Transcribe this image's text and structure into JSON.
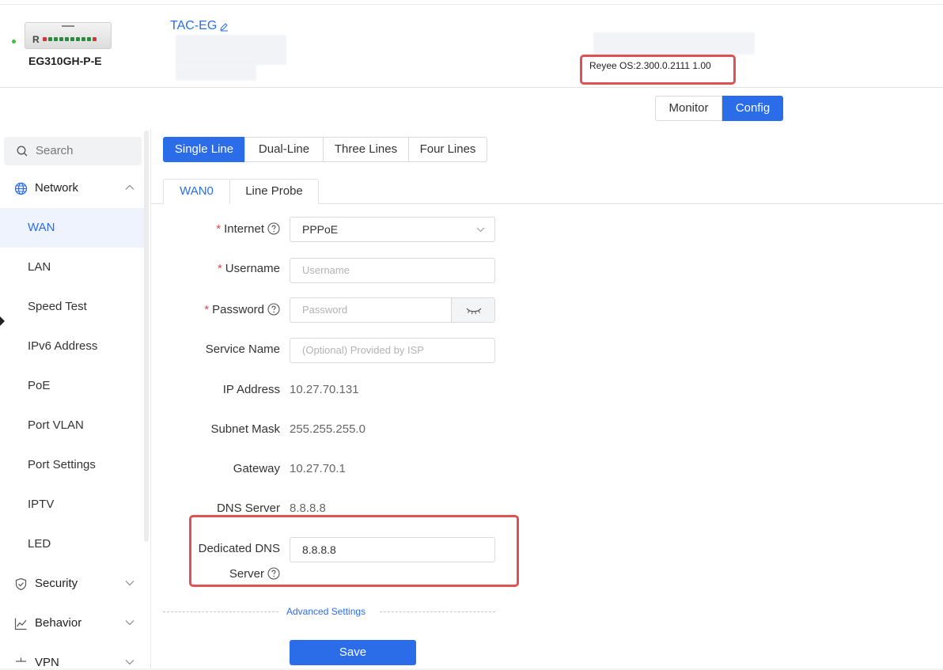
{
  "header": {
    "brand_letter": "R",
    "model": "EG310GH-P-E",
    "device_name": "TAC-EG",
    "os_version": "Reyee OS:2.300.0.2111 1.00"
  },
  "mode": {
    "monitor_label": "Monitor",
    "config_label": "Config",
    "active": "Config"
  },
  "sidebar": {
    "search_placeholder": "Search",
    "groups": [
      {
        "label": "Network",
        "icon": "globe-icon",
        "expanded": true
      },
      {
        "label": "Security",
        "icon": "shield-icon",
        "expanded": false
      },
      {
        "label": "Behavior",
        "icon": "chart-icon",
        "expanded": false
      },
      {
        "label": "VPN",
        "icon": "vpn-icon",
        "expanded": false
      }
    ],
    "items": [
      {
        "label": "WAN",
        "active": true
      },
      {
        "label": "LAN"
      },
      {
        "label": "Speed Test"
      },
      {
        "label": "IPv6 Address"
      },
      {
        "label": "PoE"
      },
      {
        "label": "Port VLAN"
      },
      {
        "label": "Port Settings"
      },
      {
        "label": "IPTV"
      },
      {
        "label": "LED"
      }
    ]
  },
  "line_tabs": [
    {
      "label": "Single Line",
      "active": true
    },
    {
      "label": "Dual-Line"
    },
    {
      "label": "Three Lines"
    },
    {
      "label": "Four Lines"
    }
  ],
  "sub_tabs": [
    {
      "label": "WAN0",
      "active": true
    },
    {
      "label": "Line Probe"
    }
  ],
  "form": {
    "internet_label": "Internet",
    "internet_value": "PPPoE",
    "username_label": "Username",
    "username_placeholder": "Username",
    "password_label": "Password",
    "password_placeholder": "Password",
    "service_name_label": "Service Name",
    "service_name_placeholder": "(Optional) Provided by ISP",
    "ip_label": "IP Address",
    "ip_value": "10.27.70.131",
    "mask_label": "Subnet Mask",
    "mask_value": "255.255.255.0",
    "gateway_label": "Gateway",
    "gateway_value": "10.27.70.1",
    "dns_label": "DNS Server",
    "dns_value": "8.8.8.8",
    "dedicated_dns_label_1": "Dedicated DNS",
    "dedicated_dns_label_2": "Server",
    "dedicated_dns_value": "8.8.8.8",
    "required_mark": "*"
  },
  "advanced_label": "Advanced Settings",
  "save_label": "Save",
  "colors": {
    "accent": "#2b6de8",
    "highlight_box": "#e05252",
    "status_online": "#3cc13b"
  }
}
